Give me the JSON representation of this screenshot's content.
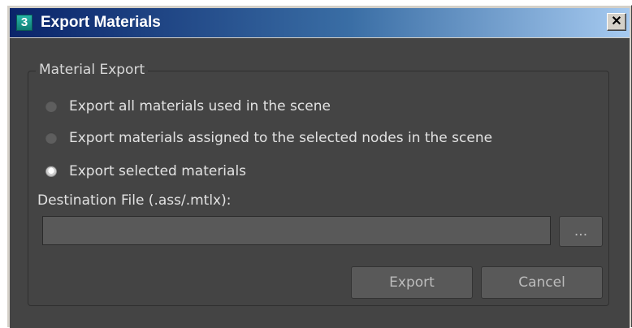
{
  "window": {
    "title": "Export Materials",
    "app_icon_glyph": "3",
    "close_glyph": "✕"
  },
  "group": {
    "title": "Material Export"
  },
  "options": [
    {
      "label": "Export all materials used in the scene",
      "selected": false
    },
    {
      "label": "Export materials assigned to the selected nodes in the scene",
      "selected": false
    },
    {
      "label": "Export selected materials",
      "selected": true
    }
  ],
  "destination": {
    "label": "Destination File (.ass/.mtlx):",
    "value": "",
    "browse_label": "..."
  },
  "buttons": {
    "export_label": "Export",
    "cancel_label": "Cancel"
  },
  "colors": {
    "dialog_bg": "#444444",
    "titlebar_start": "#0a246a",
    "titlebar_end": "#a6caf0",
    "text": "#e2e2e2"
  },
  "icons": {
    "app": "3ds-max-icon",
    "close": "close-icon"
  }
}
